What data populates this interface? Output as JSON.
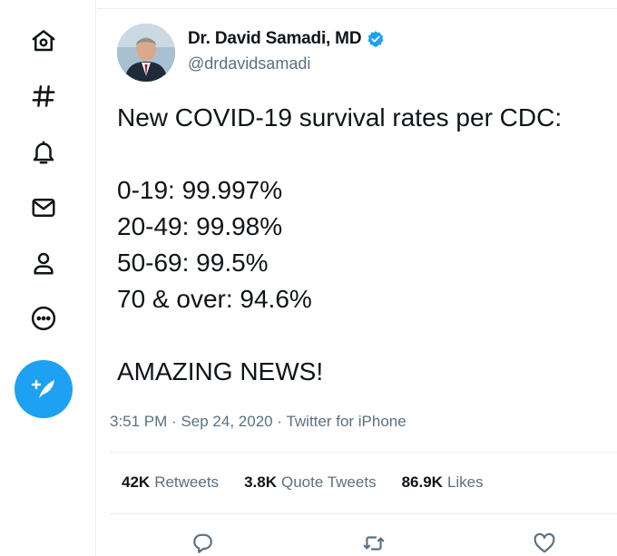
{
  "sidebar": {
    "icons": [
      "home-icon",
      "explore-icon",
      "notifications-icon",
      "messages-icon",
      "profile-icon",
      "more-icon"
    ],
    "compose_icon": "compose-tweet-icon"
  },
  "tweet": {
    "author_name": "Dr. David Samadi, MD",
    "author_handle": "@drdavidsamadi",
    "lines": [
      "New COVID-19 survival rates per CDC:",
      "",
      "0-19: 99.997%",
      "20-49: 99.98%",
      "50-69: 99.5%",
      "70 & over: 94.6%",
      "",
      "AMAZING NEWS!"
    ],
    "time": "3:51 PM",
    "date": "Sep 24, 2020",
    "source": "Twitter for iPhone",
    "separator": "·"
  },
  "stats": {
    "retweets_count": "42K",
    "retweets_label": "Retweets",
    "quotes_count": "3.8K",
    "quotes_label": "Quote Tweets",
    "likes_count": "86.9K",
    "likes_label": "Likes"
  },
  "actions": [
    "reply-icon",
    "retweet-icon",
    "like-icon"
  ],
  "colors": {
    "accent": "#1da1f2",
    "text": "#0f1419",
    "muted": "#5b7083",
    "border": "#e6ecf0"
  }
}
